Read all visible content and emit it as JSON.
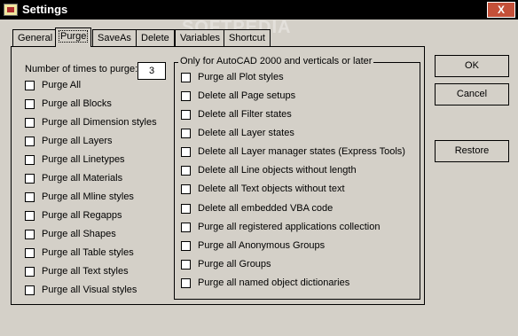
{
  "window": {
    "title": "Settings",
    "close_glyph": "X",
    "watermark": "SOFTPEDIA"
  },
  "tabs": [
    {
      "label": "General"
    },
    {
      "label": "Purge"
    },
    {
      "label": "SaveAs"
    },
    {
      "label": "Delete"
    },
    {
      "label": "Variables"
    },
    {
      "label": "Shortcut"
    }
  ],
  "purge": {
    "times_label": "Number of times to purge:",
    "times_value": "3",
    "left_options": [
      {
        "label": "Purge All",
        "checked": false
      },
      {
        "label": "Purge all Blocks",
        "checked": false
      },
      {
        "label": "Purge all Dimension styles",
        "checked": false
      },
      {
        "label": "Purge all Layers",
        "checked": false
      },
      {
        "label": "Purge all Linetypes",
        "checked": false
      },
      {
        "label": "Purge all Materials",
        "checked": false
      },
      {
        "label": "Purge all Mline styles",
        "checked": false
      },
      {
        "label": "Purge all Regapps",
        "checked": false
      },
      {
        "label": "Purge all Shapes",
        "checked": false
      },
      {
        "label": "Purge all Table styles",
        "checked": false
      },
      {
        "label": "Purge all Text styles",
        "checked": false
      },
      {
        "label": "Purge all Visual styles",
        "checked": false
      }
    ],
    "group_title": "Only for AutoCAD 2000 and verticals or later",
    "right_options": [
      {
        "label": "Purge all Plot styles",
        "checked": false
      },
      {
        "label": "Delete all Page setups",
        "checked": false
      },
      {
        "label": "Delete all Filter states",
        "checked": false
      },
      {
        "label": "Delete all Layer states",
        "checked": false
      },
      {
        "label": "Delete all Layer manager states (Express Tools)",
        "checked": false
      },
      {
        "label": "Delete all Line objects without length",
        "checked": false
      },
      {
        "label": "Delete all Text objects without text",
        "checked": false
      },
      {
        "label": "Delete all embedded VBA code",
        "checked": false
      },
      {
        "label": "Purge all registered applications collection",
        "checked": false
      },
      {
        "label": "Purge all Anonymous Groups",
        "checked": false
      },
      {
        "label": "Purge all Groups",
        "checked": false
      },
      {
        "label": "Purge all named object dictionaries",
        "checked": false
      }
    ]
  },
  "buttons": {
    "ok": "OK",
    "cancel": "Cancel",
    "restore": "Restore"
  }
}
